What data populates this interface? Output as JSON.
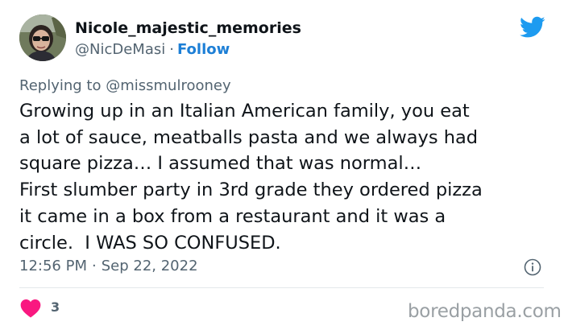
{
  "user": {
    "display_name": "Nicole_majestic_memories",
    "handle": "@NicDeMasi",
    "separator": "·",
    "follow_label": "Follow"
  },
  "reply": {
    "prefix": "Replying to",
    "mention": "@missmulrooney"
  },
  "body": {
    "lines": [
      "Growing up in an Italian American family, you eat",
      "a lot of sauce, meatballs pasta and we always had",
      "square pizza… I assumed that was normal…",
      "First slumber party in 3rd grade they ordered pizza",
      "it came in a box from a restaurant and it was a",
      "circle.  I WAS SO CONFUSED."
    ]
  },
  "meta": {
    "time": "12:56 PM",
    "separator": "·",
    "date": "Sep 22, 2022"
  },
  "engagement": {
    "like_count": "3"
  },
  "watermark": {
    "text": "boredpanda.com"
  },
  "icons": {
    "brand": "twitter-bird-icon",
    "info": "info-icon",
    "like": "heart-icon"
  },
  "colors": {
    "text": "#0f1419",
    "secondary": "#536471",
    "link": "#1d7fd6",
    "twitter_blue": "#1d9bf0",
    "heart": "#f91880",
    "watermark": "#9aa0a4"
  }
}
